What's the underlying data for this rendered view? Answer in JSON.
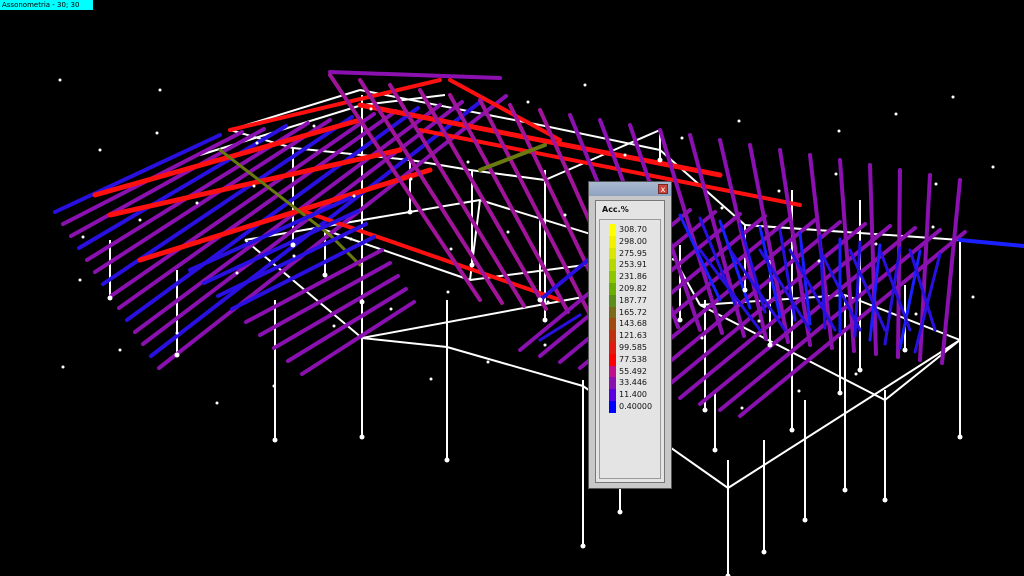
{
  "view": {
    "label": "Assonometria - 30; 30"
  },
  "legend": {
    "title": "Acc.%",
    "close_glyph": "x",
    "entries": [
      {
        "value": "308.70",
        "color": "#ffff00"
      },
      {
        "value": "298.00",
        "color": "#f2f200"
      },
      {
        "value": "275.95",
        "color": "#d9e600"
      },
      {
        "value": "253.91",
        "color": "#b5d800"
      },
      {
        "value": "231.86",
        "color": "#8cc800"
      },
      {
        "value": "209.82",
        "color": "#6aae00"
      },
      {
        "value": "187.77",
        "color": "#5a8f1a"
      },
      {
        "value": "165.72",
        "color": "#7a6a1a"
      },
      {
        "value": "143.68",
        "color": "#a14a10"
      },
      {
        "value": "121.63",
        "color": "#c03010"
      },
      {
        "value": "99.585",
        "color": "#e01a10"
      },
      {
        "value": "77.538",
        "color": "#ff0000"
      },
      {
        "value": "55.492",
        "color": "#c0108a"
      },
      {
        "value": "33.446",
        "color": "#8a10b0"
      },
      {
        "value": "11.400",
        "color": "#5a00e0"
      },
      {
        "value": "0.40000",
        "color": "#0000ff"
      }
    ]
  },
  "colors": {
    "background": "#000000",
    "frame": "#ffffff",
    "label_bg": "#00ffff"
  }
}
